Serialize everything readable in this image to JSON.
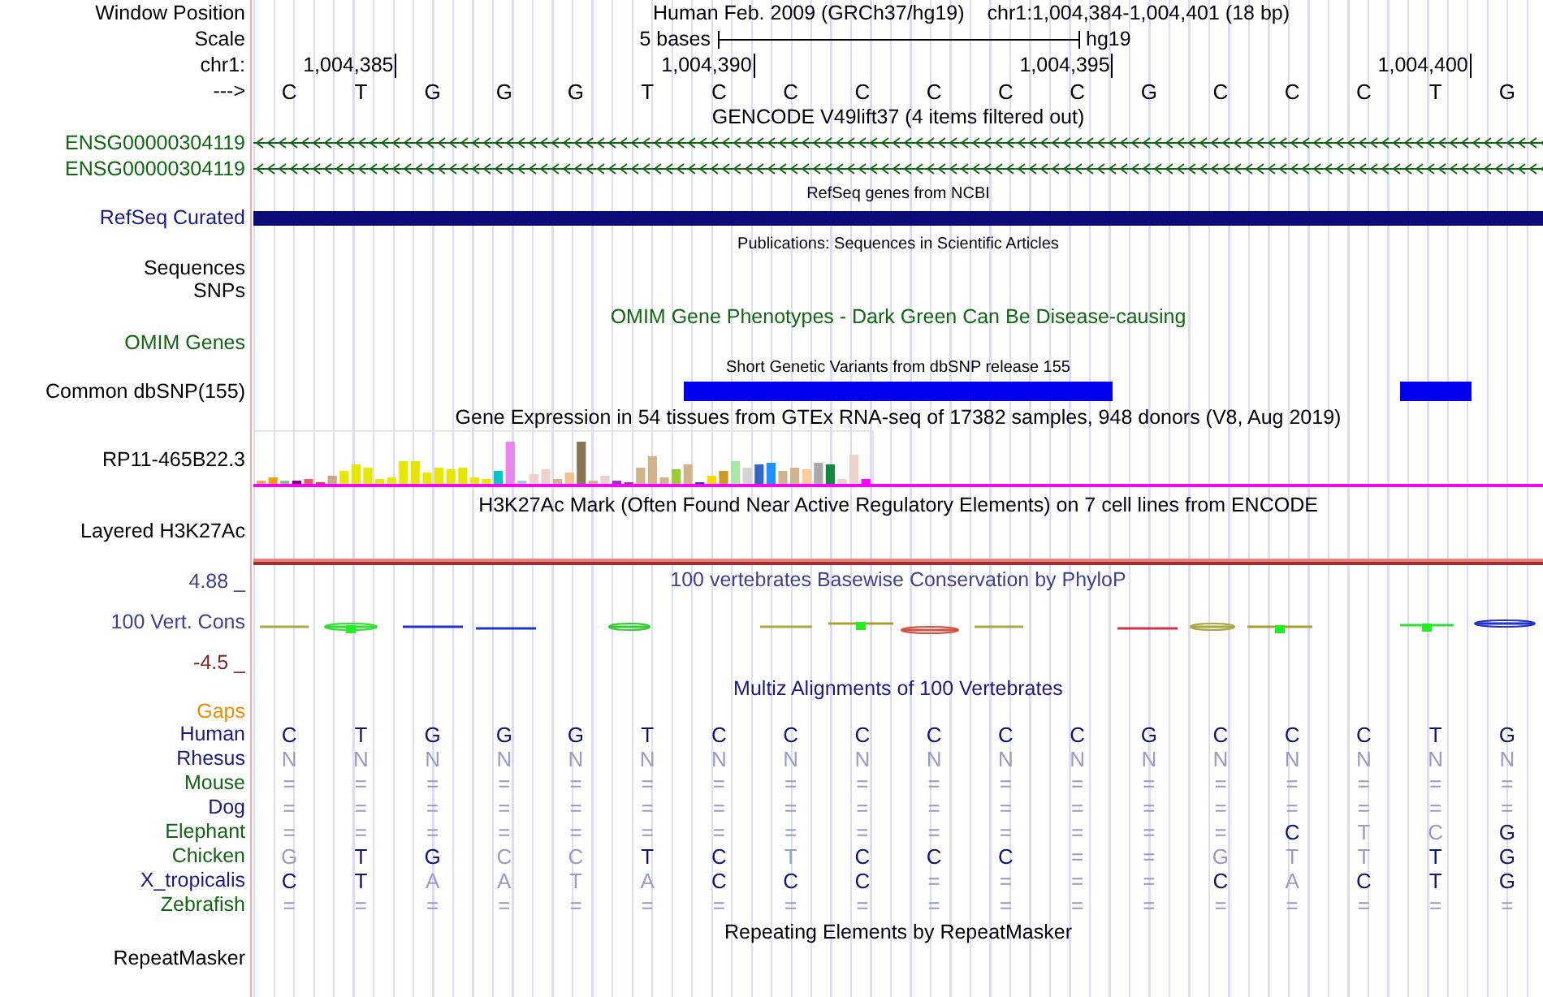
{
  "header": {
    "label": "Window Position",
    "title": "Human Feb. 2009 (GRCh37/hg19)",
    "position": "chr1:1,004,384-1,004,401 (18 bp)"
  },
  "scale": {
    "label": "Scale",
    "bar_text": "5 bases",
    "assembly": "hg19"
  },
  "ruler": {
    "label": "chr1:",
    "ticks": [
      "1,004,385",
      "1,004,390",
      "1,004,395",
      "1,004,400"
    ]
  },
  "sequence": {
    "label": "--->",
    "bases": [
      "C",
      "T",
      "G",
      "G",
      "G",
      "T",
      "C",
      "C",
      "C",
      "C",
      "C",
      "C",
      "G",
      "C",
      "C",
      "C",
      "T",
      "G"
    ]
  },
  "gencode": {
    "title": "GENCODE V49lift37 (4 items filtered out)",
    "genes": [
      {
        "label": "ENSG00000304119"
      },
      {
        "label": "ENSG00000304119"
      }
    ]
  },
  "refseq": {
    "title": "RefSeq genes from NCBI",
    "label": "RefSeq Curated"
  },
  "publications": {
    "title": "Publications: Sequences in Scientific Articles",
    "labels": [
      "Sequences",
      "SNPs"
    ]
  },
  "omim": {
    "title": "OMIM Gene Phenotypes - Dark Green Can Be Disease-causing",
    "label": "OMIM Genes"
  },
  "dbsnp": {
    "title": "Short Genetic Variants from dbSNP release 155",
    "label": "Common dbSNP(155)"
  },
  "gtex": {
    "title": "Gene Expression in 54 tissues from GTEx RNA-seq of 17382 samples, 948 donors (V8, Aug 2019)",
    "label": "RP11-465B22.3"
  },
  "h3k27ac": {
    "title": "H3K27Ac Mark (Often Found Near Active Regulatory Elements) on 7 cell lines from ENCODE",
    "label": "Layered H3K27Ac"
  },
  "conservation": {
    "title": "100 vertebrates Basewise Conservation by PhyloP",
    "label": "100 Vert. Cons",
    "y_max": "4.88 _",
    "y_min": "-4.5 _"
  },
  "multiz": {
    "title": "Multiz Alignments of 100 Vertebrates",
    "gaps_label": "Gaps",
    "species": [
      {
        "name": "Human",
        "color": "#1a1a80",
        "bases": [
          {
            "base": "C",
            "match": true
          },
          {
            "base": "T",
            "match": true
          },
          {
            "base": "G",
            "match": true
          },
          {
            "base": "G",
            "match": true
          },
          {
            "base": "G",
            "match": true
          },
          {
            "base": "T",
            "match": true
          },
          {
            "base": "C",
            "match": true
          },
          {
            "base": "C",
            "match": true
          },
          {
            "base": "C",
            "match": true
          },
          {
            "base": "C",
            "match": true
          },
          {
            "base": "C",
            "match": true
          },
          {
            "base": "C",
            "match": true
          },
          {
            "base": "G",
            "match": true
          },
          {
            "base": "C",
            "match": true
          },
          {
            "base": "C",
            "match": true
          },
          {
            "base": "C",
            "match": true
          },
          {
            "base": "T",
            "match": true
          },
          {
            "base": "G",
            "match": true
          }
        ]
      },
      {
        "name": "Rhesus",
        "color": "#1a1a80",
        "bases": [
          {
            "base": "N",
            "match": false
          },
          {
            "base": "N",
            "match": false
          },
          {
            "base": "N",
            "match": false
          },
          {
            "base": "N",
            "match": false
          },
          {
            "base": "N",
            "match": false
          },
          {
            "base": "N",
            "match": false
          },
          {
            "base": "N",
            "match": false
          },
          {
            "base": "N",
            "match": false
          },
          {
            "base": "N",
            "match": false
          },
          {
            "base": "N",
            "match": false
          },
          {
            "base": "N",
            "match": false
          },
          {
            "base": "N",
            "match": false
          },
          {
            "base": "N",
            "match": false
          },
          {
            "base": "N",
            "match": false
          },
          {
            "base": "N",
            "match": false
          },
          {
            "base": "N",
            "match": false
          },
          {
            "base": "N",
            "match": false
          },
          {
            "base": "N",
            "match": false
          }
        ]
      },
      {
        "name": "Mouse",
        "color": "#116611",
        "bases": [
          {
            "base": "=",
            "match": false
          },
          {
            "base": "=",
            "match": false
          },
          {
            "base": "=",
            "match": false
          },
          {
            "base": "=",
            "match": false
          },
          {
            "base": "=",
            "match": false
          },
          {
            "base": "=",
            "match": false
          },
          {
            "base": "=",
            "match": false
          },
          {
            "base": "=",
            "match": false
          },
          {
            "base": "=",
            "match": false
          },
          {
            "base": "=",
            "match": false
          },
          {
            "base": "=",
            "match": false
          },
          {
            "base": "=",
            "match": false
          },
          {
            "base": "=",
            "match": false
          },
          {
            "base": "=",
            "match": false
          },
          {
            "base": "=",
            "match": false
          },
          {
            "base": "=",
            "match": false
          },
          {
            "base": "=",
            "match": false
          },
          {
            "base": "=",
            "match": false
          }
        ]
      },
      {
        "name": "Dog",
        "color": "#1a1a80",
        "bases": [
          {
            "base": "=",
            "match": false
          },
          {
            "base": "=",
            "match": false
          },
          {
            "base": "=",
            "match": false
          },
          {
            "base": "=",
            "match": false
          },
          {
            "base": "=",
            "match": false
          },
          {
            "base": "=",
            "match": false
          },
          {
            "base": "=",
            "match": false
          },
          {
            "base": "=",
            "match": false
          },
          {
            "base": "=",
            "match": false
          },
          {
            "base": "=",
            "match": false
          },
          {
            "base": "=",
            "match": false
          },
          {
            "base": "=",
            "match": false
          },
          {
            "base": "=",
            "match": false
          },
          {
            "base": "=",
            "match": false
          },
          {
            "base": "=",
            "match": false
          },
          {
            "base": "=",
            "match": false
          },
          {
            "base": "=",
            "match": false
          },
          {
            "base": "=",
            "match": false
          }
        ]
      },
      {
        "name": "Elephant",
        "color": "#116611",
        "bases": [
          {
            "base": "=",
            "match": false
          },
          {
            "base": "=",
            "match": false
          },
          {
            "base": "=",
            "match": false
          },
          {
            "base": "=",
            "match": false
          },
          {
            "base": "=",
            "match": false
          },
          {
            "base": "=",
            "match": false
          },
          {
            "base": "=",
            "match": false
          },
          {
            "base": "=",
            "match": false
          },
          {
            "base": "=",
            "match": false
          },
          {
            "base": "=",
            "match": false
          },
          {
            "base": "=",
            "match": false
          },
          {
            "base": "=",
            "match": false
          },
          {
            "base": "=",
            "match": false
          },
          {
            "base": "=",
            "match": false
          },
          {
            "base": "C",
            "match": true
          },
          {
            "base": "T",
            "match": false
          },
          {
            "base": "C",
            "match": false
          },
          {
            "base": "G",
            "match": true
          }
        ]
      },
      {
        "name": "Chicken",
        "color": "#116611",
        "bases": [
          {
            "base": "G",
            "match": false
          },
          {
            "base": "T",
            "match": true
          },
          {
            "base": "G",
            "match": true
          },
          {
            "base": "C",
            "match": false
          },
          {
            "base": "C",
            "match": false
          },
          {
            "base": "T",
            "match": true
          },
          {
            "base": "C",
            "match": true
          },
          {
            "base": "T",
            "match": false
          },
          {
            "base": "C",
            "match": true
          },
          {
            "base": "C",
            "match": true
          },
          {
            "base": "C",
            "match": true
          },
          {
            "base": "=",
            "match": false
          },
          {
            "base": "=",
            "match": false
          },
          {
            "base": "G",
            "match": false
          },
          {
            "base": "T",
            "match": false
          },
          {
            "base": "T",
            "match": false
          },
          {
            "base": "T",
            "match": true
          },
          {
            "base": "G",
            "match": true
          }
        ]
      },
      {
        "name": "X_tropicalis",
        "color": "#1a1a80",
        "bases": [
          {
            "base": "C",
            "match": true
          },
          {
            "base": "T",
            "match": true
          },
          {
            "base": "A",
            "match": false
          },
          {
            "base": "A",
            "match": false
          },
          {
            "base": "T",
            "match": false
          },
          {
            "base": "A",
            "match": false
          },
          {
            "base": "C",
            "match": true
          },
          {
            "base": "C",
            "match": true
          },
          {
            "base": "C",
            "match": true
          },
          {
            "base": "=",
            "match": false
          },
          {
            "base": "=",
            "match": false
          },
          {
            "base": "=",
            "match": false
          },
          {
            "base": "=",
            "match": false
          },
          {
            "base": "C",
            "match": true
          },
          {
            "base": "A",
            "match": false
          },
          {
            "base": "C",
            "match": true
          },
          {
            "base": "T",
            "match": true
          },
          {
            "base": "G",
            "match": true
          }
        ]
      },
      {
        "name": "Zebrafish",
        "color": "#116611",
        "bases": [
          {
            "base": "=",
            "match": false
          },
          {
            "base": "=",
            "match": false
          },
          {
            "base": "=",
            "match": false
          },
          {
            "base": "=",
            "match": false
          },
          {
            "base": "=",
            "match": false
          },
          {
            "base": "=",
            "match": false
          },
          {
            "base": "=",
            "match": false
          },
          {
            "base": "=",
            "match": false
          },
          {
            "base": "=",
            "match": false
          },
          {
            "base": "=",
            "match": false
          },
          {
            "base": "=",
            "match": false
          },
          {
            "base": "=",
            "match": false
          },
          {
            "base": "=",
            "match": false
          },
          {
            "base": "=",
            "match": false
          },
          {
            "base": "=",
            "match": false
          },
          {
            "base": "=",
            "match": false
          },
          {
            "base": "=",
            "match": false
          },
          {
            "base": "=",
            "match": false
          }
        ]
      }
    ]
  },
  "repeatmasker": {
    "title": "Repeating Elements by RepeatMasker",
    "label": "RepeatMasker"
  }
}
